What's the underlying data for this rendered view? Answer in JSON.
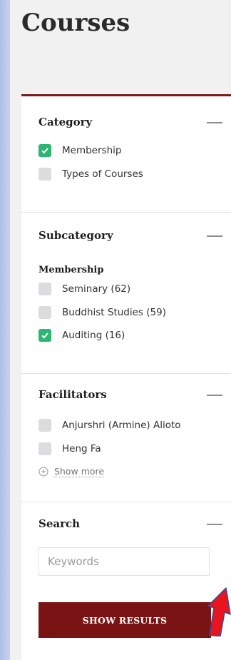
{
  "page": {
    "title": "Courses"
  },
  "filters": {
    "category": {
      "title": "Category",
      "options": [
        {
          "label": "Membership",
          "checked": true
        },
        {
          "label": "Types of Courses",
          "checked": false
        }
      ]
    },
    "subcategory": {
      "title": "Subcategory",
      "group_label": "Membership",
      "options": [
        {
          "label": "Seminary (62)",
          "checked": false
        },
        {
          "label": "Buddhist Studies (59)",
          "checked": false
        },
        {
          "label": "Auditing (16)",
          "checked": true
        }
      ]
    },
    "facilitators": {
      "title": "Facilitators",
      "options": [
        {
          "label": "Anjurshri (Armine) Alioto",
          "checked": false
        },
        {
          "label": "Heng Fa",
          "checked": false
        }
      ],
      "show_more_label": "Show more"
    },
    "search": {
      "title": "Search",
      "placeholder": "Keywords",
      "value": ""
    },
    "submit_label": "SHOW RESULTS"
  },
  "colors": {
    "accent": "#7a1414",
    "checked": "#2bb673",
    "annotation_arrow": "#e8141e"
  }
}
